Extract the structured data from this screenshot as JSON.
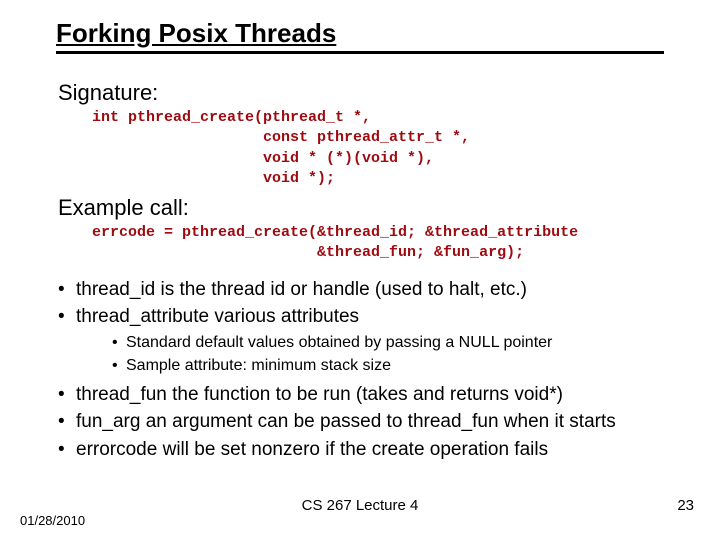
{
  "title": "Forking Posix Threads",
  "signature_label": "Signature:",
  "signature_code": "int pthread_create(pthread_t *,\n                   const pthread_attr_t *,\n                   void * (*)(void *),\n                   void *);",
  "example_label": "Example call:",
  "example_code": "errcode = pthread_create(&thread_id; &thread_attribute\n                         &thread_fun; &fun_arg);",
  "bullets": [
    {
      "text": "thread_id  is the thread id or handle (used to halt, etc.)"
    },
    {
      "text": "thread_attribute various attributes",
      "sub": [
        "Standard default values obtained by passing a NULL pointer",
        "Sample attribute: minimum stack size"
      ]
    },
    {
      "text": "thread_fun the function to be run (takes and returns void*)"
    },
    {
      "text": "fun_arg an argument can be passed to thread_fun when it starts"
    },
    {
      "text": "errorcode will be set nonzero if the create operation fails"
    }
  ],
  "footer": {
    "date": "01/28/2010",
    "lecture": "CS 267 Lecture 4",
    "page": "23"
  }
}
